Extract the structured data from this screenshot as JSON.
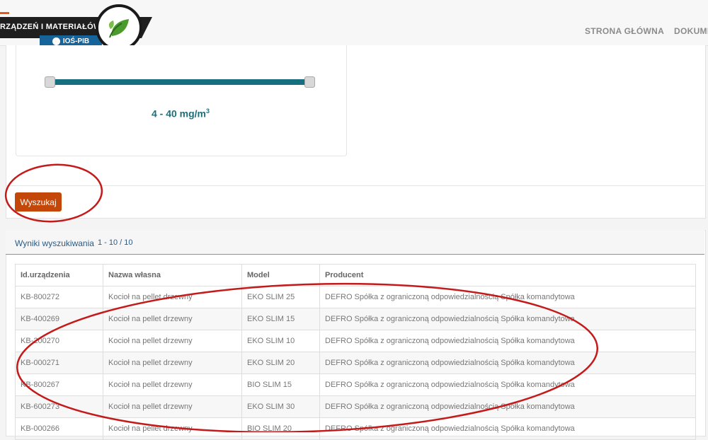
{
  "header": {
    "brand_text": "RZĄDZEŃ I MATERIAŁÓW",
    "brand_sub": "IOŚ-PIB",
    "nav": [
      "STRONA GŁÓWNA",
      "DOKUME"
    ]
  },
  "filter": {
    "range_value": "4 - 40 mg/m",
    "range_unit_sup": "3",
    "search_button": "Wyszukaj"
  },
  "results": {
    "title": "Wyniki wyszukiwania",
    "count": "1 - 10  / 10",
    "columns": [
      "Id.urządzenia",
      "Nazwa własna",
      "Model",
      "Producent"
    ],
    "rows": [
      [
        "KB-800272",
        "Kocioł na pellet drzewny",
        "EKO SLIM 25",
        "DEFRO Spółka z ograniczoną odpowiedzialnością Spółka komandytowa"
      ],
      [
        "KB-400269",
        "Kocioł na pellet drzewny",
        "EKO SLIM 15",
        "DEFRO Spółka z ograniczoną odpowiedzialnością Spółka komandytowa"
      ],
      [
        "KB-200270",
        "Kocioł na pellet drzewny",
        "EKO SLIM 10",
        "DEFRO Spółka z ograniczoną odpowiedzialnością Spółka komandytowa"
      ],
      [
        "KB-000271",
        "Kocioł na pellet drzewny",
        "EKO SLIM 20",
        "DEFRO Spółka z ograniczoną odpowiedzialnością Spółka komandytowa"
      ],
      [
        "KB-800267",
        "Kocioł na pellet drzewny",
        "BIO SLIM 15",
        "DEFRO Spółka z ograniczoną odpowiedzialnością Spółka komandytowa"
      ],
      [
        "KB-600273",
        "Kocioł na pellet drzewny",
        "EKO SLIM 30",
        "DEFRO Spółka z ograniczoną odpowiedzialnością Spółka komandytowa"
      ],
      [
        "KB-000266",
        "Kocioł na pellet drzewny",
        "BIO SLIM 20",
        "DEFRO Spółka z ograniczoną odpowiedzialnością Spółka komandytowa"
      ]
    ]
  },
  "colors": {
    "accent": "#c34708",
    "slider": "#156f7e",
    "annotation": "#c41a1a"
  },
  "icons": [
    "leaf-icon",
    "ios-pib-logo-icon"
  ]
}
